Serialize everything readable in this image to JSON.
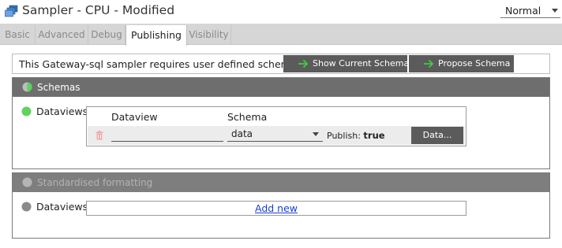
{
  "window": {
    "title": "Sampler - CPU - Modified",
    "mode": "Normal"
  },
  "tabs": [
    {
      "label": "Basic",
      "active": false
    },
    {
      "label": "Advanced",
      "active": false
    },
    {
      "label": "Debug",
      "active": false
    },
    {
      "label": "Publishing",
      "active": true
    },
    {
      "label": "Visibility",
      "active": false
    }
  ],
  "notice": {
    "message": "This Gateway-sql sampler requires user defined schema(s)",
    "show_schema_label": "Show Current Schema",
    "propose_schema_label": "Propose Schema"
  },
  "schemas": {
    "heading": "Schemas",
    "dataviews_label": "Dataviews",
    "columns": {
      "dataview": "Dataview",
      "schema": "Schema"
    },
    "row": {
      "dataview_value": "",
      "schema_value": "data",
      "publish_label": "Publish:",
      "publish_value": "true",
      "data_button_label": "Data..."
    }
  },
  "formatting": {
    "heading": "Standardised formatting",
    "dataviews_label": "Dataviews",
    "add_new_label": "Add new"
  },
  "colors": {
    "header_bg": "#6e6e6e",
    "button_bg": "#5b5b5b",
    "green_arrow": "#3fce3f",
    "status_green": "#5fd35f",
    "link_blue": "#1a3fd1"
  }
}
